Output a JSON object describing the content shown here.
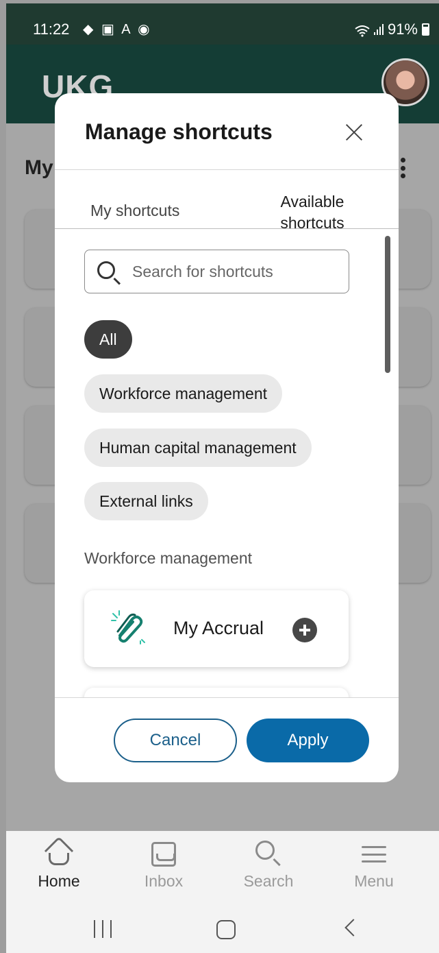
{
  "status_bar": {
    "time": "11:22",
    "left_icons": "◆ ▣ A ◉",
    "battery": "91%"
  },
  "header": {
    "logo": "UKG"
  },
  "background_page": {
    "title": "My"
  },
  "modal": {
    "title": "Manage shortcuts",
    "tabs": [
      {
        "label": "My shortcuts",
        "selected": false
      },
      {
        "label": "Available shortcuts",
        "selected": true
      }
    ],
    "search": {
      "placeholder": "Search for shortcuts",
      "value": ""
    },
    "filters": [
      {
        "label": "All",
        "active": true
      },
      {
        "label": "Workforce management",
        "active": false
      },
      {
        "label": "Human capital management",
        "active": false
      },
      {
        "label": "External links",
        "active": false
      }
    ],
    "section_label": "Workforce management",
    "shortcuts": [
      {
        "label": "My Accrual",
        "icon": "paperclip-icon",
        "action": "add-icon"
      }
    ],
    "cancel_label": "Cancel",
    "apply_label": "Apply",
    "colors": {
      "apply": "#0a6aa8",
      "cancel_border": "#1b5f8a",
      "chip_active": "#3d3d3d",
      "header": "#143d35"
    }
  },
  "bottom_nav": {
    "items": [
      {
        "label": "Home",
        "icon": "home-icon",
        "active": true
      },
      {
        "label": "Inbox",
        "icon": "inbox-icon",
        "active": false
      },
      {
        "label": "Search",
        "icon": "search-icon",
        "active": false
      },
      {
        "label": "Menu",
        "icon": "menu-icon",
        "active": false
      }
    ]
  }
}
